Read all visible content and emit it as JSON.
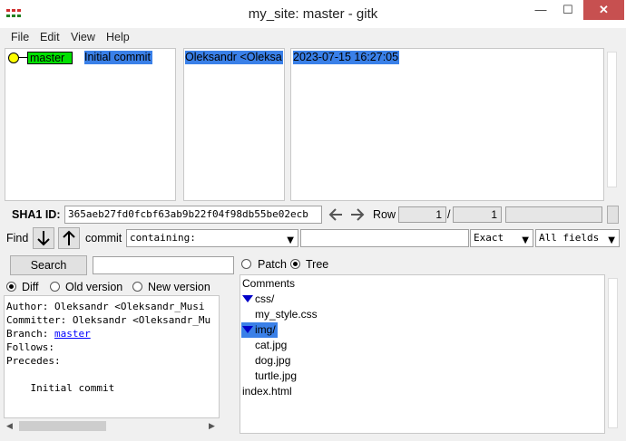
{
  "window": {
    "title": "my_site: master - gitk",
    "minimize": "—",
    "maximize": "☐",
    "close": "✕"
  },
  "menu": [
    "File",
    "Edit",
    "View",
    "Help"
  ],
  "commit_list": {
    "branch": "master",
    "message": "Initial commit",
    "author": "Oleksandr <Oleksa",
    "date": "2023-07-15 16:27:05"
  },
  "sha_bar": {
    "label": "SHA1 ID:",
    "value": "365aeb27fd0fcbf63ab9b22f04f98db55be02ecb",
    "row_label": "Row",
    "row_current": "1",
    "row_sep": "/",
    "row_total": "1"
  },
  "find_bar": {
    "label": "Find",
    "commit_label": "commit",
    "type_value": "containing:",
    "mode_value": "Exact",
    "fields_value": "All fields"
  },
  "search": {
    "button_label": "Search"
  },
  "diff_options": {
    "diff": "Diff",
    "old_version": "Old version",
    "new_version": "New version",
    "selected": "Diff"
  },
  "view_options": {
    "patch": "Patch",
    "tree": "Tree",
    "selected": "Tree"
  },
  "details": {
    "author_line": "Author: Oleksandr <Oleksandr_Musi",
    "committer_line": "Committer: Oleksandr <Oleksandr_Mu",
    "branch_label": "Branch: ",
    "branch_link": "master",
    "follows": "Follows:",
    "precedes": "Precedes:",
    "message": "    Initial commit"
  },
  "file_tree": {
    "comments": "Comments",
    "folder1": "css/",
    "file1": "my_style.css",
    "folder2": "img/",
    "file2": "cat.jpg",
    "file3": "dog.jpg",
    "file4": "turtle.jpg",
    "file5": "index.html"
  },
  "colors": {
    "selection": "#3a80e8",
    "branch_tag": "#00e000",
    "commit_dot": "#ffff00",
    "tree_arrow": "#0000c8"
  }
}
